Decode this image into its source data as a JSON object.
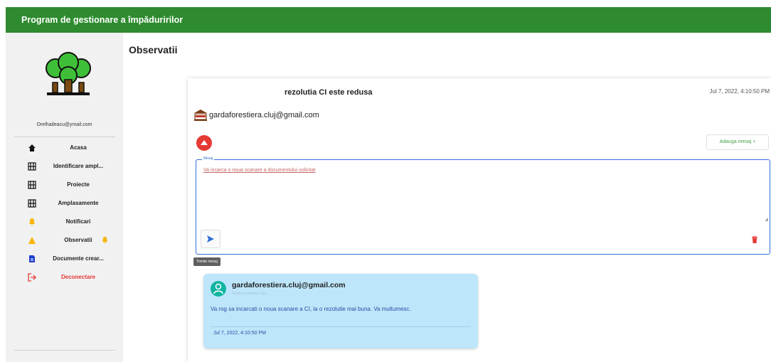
{
  "app": {
    "title": "Program de gestionare a împăduririlor"
  },
  "user": {
    "email": "Orelhaileacu@ymail.com"
  },
  "sidebar": {
    "items": [
      {
        "label": "Acasa",
        "icon": "home-icon"
      },
      {
        "label": "Identificare ampl...",
        "icon": "map-frame-icon"
      },
      {
        "label": "Proiecte",
        "icon": "map-frame-icon"
      },
      {
        "label": "Amplasamente",
        "icon": "map-frame-icon"
      },
      {
        "label": "Notificari",
        "icon": "bell-icon"
      },
      {
        "label": "Observatii",
        "icon": "warning-icon",
        "badge_icon": "bell-icon"
      },
      {
        "label": "Documente crear...",
        "icon": "document-icon"
      },
      {
        "label": "Deconectare",
        "icon": "logout-icon"
      }
    ]
  },
  "page": {
    "title": "Observatii"
  },
  "observation": {
    "title": "rezolutia CI este redusa",
    "date": "Jul 7, 2022, 4:10:50 PM",
    "sender": "gardaforestiera.cluj@gmail.com",
    "add_message_label": "Adauga mesaj +",
    "compose": {
      "legend": "Mesaj",
      "placeholder": "Va incarca o noua scanare a documentului solicitat",
      "send_tooltip": "Trimite mesaj"
    }
  },
  "reply": {
    "from": "gardaforestiera.cluj@gmail.com",
    "org": "Garda Forestiera Cluj",
    "text": "Va rog sa incarcati o noua scanare a CI, la o rezolutie mai buna. Va multumesc.",
    "date": "Jul 7, 2022, 4:10:50 PM"
  },
  "colors": {
    "brand": "#2e8b2f",
    "danger": "#e53935",
    "accent": "#2f6fd6",
    "reply_bg": "#bde6fb",
    "warning": "#f6b400"
  }
}
